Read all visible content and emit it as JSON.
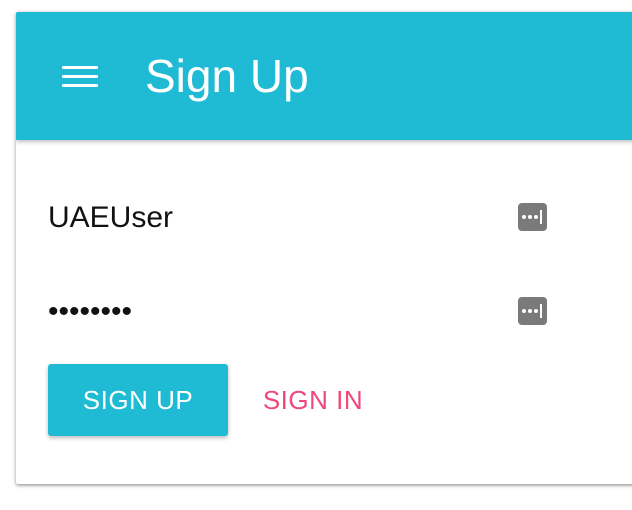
{
  "header": {
    "title": "Sign Up",
    "menu_icon": "hamburger-menu-icon",
    "background_color": "#1fbbd4"
  },
  "form": {
    "username": {
      "value": "UAEUser",
      "icon": "password-manager-icon"
    },
    "password": {
      "value": "••••••••",
      "icon": "password-manager-icon"
    }
  },
  "actions": {
    "signup_label": "SIGN UP",
    "signin_label": "SIGN IN",
    "signup_color": "#1fbbd4",
    "signin_color": "#f0487c"
  }
}
